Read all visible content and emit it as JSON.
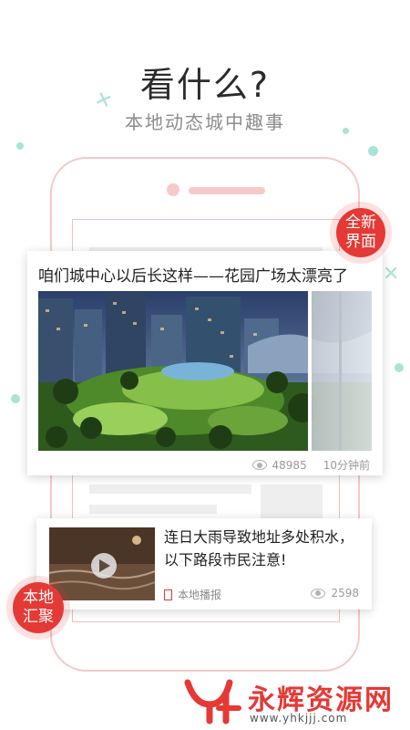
{
  "header": {
    "headline": "看什么?",
    "subline": "本地动态城中趣事"
  },
  "badges": {
    "new_ui": "全新\n界面",
    "local": "本地\n汇聚"
  },
  "featured": {
    "title": "咱们城中心以后长这样——花园广场太漂亮了",
    "views": "48985",
    "time": "10分钟前"
  },
  "news_item": {
    "title": "连日大雨导致地址多处积水，以下路段市民注意!",
    "source": "本地播报",
    "views": "2598"
  },
  "watermark": {
    "brand": "永辉资源网",
    "url": "www.yhkjjj.com"
  },
  "colors": {
    "accent": "#e53935",
    "decor": "#a9e4d7",
    "frame": "#f6c8c8"
  }
}
